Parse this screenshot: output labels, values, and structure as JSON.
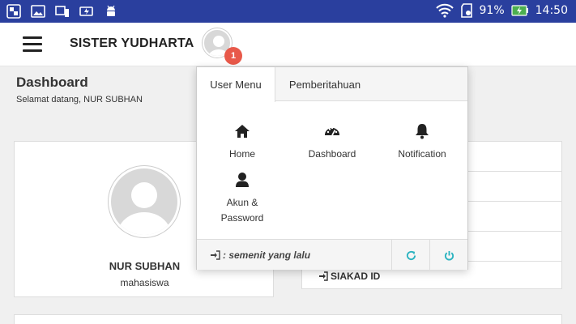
{
  "statusbar": {
    "battery_percent": "91%",
    "time": "14:50",
    "icons_left": [
      "screenshot-icon",
      "image-icon",
      "devices-icon",
      "charging-icon",
      "android-icon"
    ],
    "icons_right": [
      "wifi-icon",
      "sd-card-icon",
      "battery-charging-icon"
    ]
  },
  "header": {
    "title": "SISTER YUDHARTA",
    "notification_count": "1"
  },
  "page": {
    "title": "Dashboard",
    "subtitle": "Selamat datang, NUR SUBHAN"
  },
  "profile": {
    "name": "NUR SUBHAN",
    "role": "mahasiswa"
  },
  "side_list": {
    "visible_item": "SIAKAD ID"
  },
  "popup": {
    "tabs": [
      {
        "label": "User Menu"
      },
      {
        "label": "Pemberitahuan"
      }
    ],
    "items": [
      {
        "label": "Home",
        "icon": "home-icon"
      },
      {
        "label": "Dashboard",
        "icon": "dashboard-icon"
      },
      {
        "label": "Notification",
        "icon": "bell-icon"
      },
      {
        "label_line1": "Akun &",
        "label_line2": "Password",
        "icon": "user-icon"
      }
    ],
    "footer": {
      "last_login": ": semenit yang lalu",
      "refresh_icon": "refresh-icon",
      "power_icon": "power-icon"
    }
  },
  "colors": {
    "statusbar": "#2a3f9e",
    "badge": "#e8594a",
    "footer_icon": "#2bb3c0"
  }
}
